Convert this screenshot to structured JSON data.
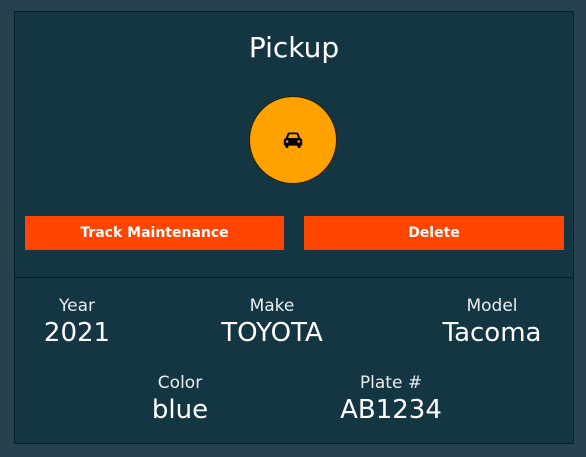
{
  "vehicle": {
    "title": "Pickup",
    "icon": "car-icon",
    "avatar_color": "#ffa200"
  },
  "actions": {
    "track_label": "Track Maintenance",
    "delete_label": "Delete",
    "button_color": "#ff4500"
  },
  "details": {
    "year_label": "Year",
    "year_value": "2021",
    "make_label": "Make",
    "make_value": "TOYOTA",
    "model_label": "Model",
    "model_value": "Tacoma",
    "color_label": "Color",
    "color_value": "blue",
    "plate_label": "Plate #",
    "plate_value": "AB1234"
  }
}
